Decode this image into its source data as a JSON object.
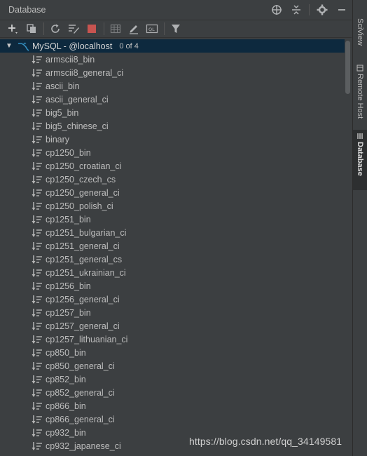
{
  "header": {
    "title": "Database",
    "icons": [
      "crosshair-icon",
      "collapse-icon",
      "gear-icon",
      "minimize-icon"
    ]
  },
  "toolbar": {
    "buttons": [
      "add-icon",
      "duplicate-icon",
      "refresh-icon",
      "edit-datasource-icon",
      "stop-icon",
      "table-view-icon",
      "edit-icon",
      "sql-console-icon",
      "filter-icon"
    ]
  },
  "tree": {
    "root_label": "MySQL - @localhost",
    "root_count": "0 of 4",
    "collations": [
      "armscii8_bin",
      "armscii8_general_ci",
      "ascii_bin",
      "ascii_general_ci",
      "big5_bin",
      "big5_chinese_ci",
      "binary",
      "cp1250_bin",
      "cp1250_croatian_ci",
      "cp1250_czech_cs",
      "cp1250_general_ci",
      "cp1250_polish_ci",
      "cp1251_bin",
      "cp1251_bulgarian_ci",
      "cp1251_general_ci",
      "cp1251_general_cs",
      "cp1251_ukrainian_ci",
      "cp1256_bin",
      "cp1256_general_ci",
      "cp1257_bin",
      "cp1257_general_ci",
      "cp1257_lithuanian_ci",
      "cp850_bin",
      "cp850_general_ci",
      "cp852_bin",
      "cp852_general_ci",
      "cp866_bin",
      "cp866_general_ci",
      "cp932_bin",
      "cp932_japanese_ci"
    ]
  },
  "side_tabs": [
    {
      "label": "SciView",
      "active": false
    },
    {
      "label": "Remote Host",
      "active": false
    },
    {
      "label": "Database",
      "active": true
    }
  ],
  "watermark": "https://blog.csdn.net/qq_34149581",
  "colors": {
    "background": "#3c3f41",
    "selection": "#0d293e",
    "stop_red": "#c75450",
    "mysql_blue": "#3592c4"
  }
}
